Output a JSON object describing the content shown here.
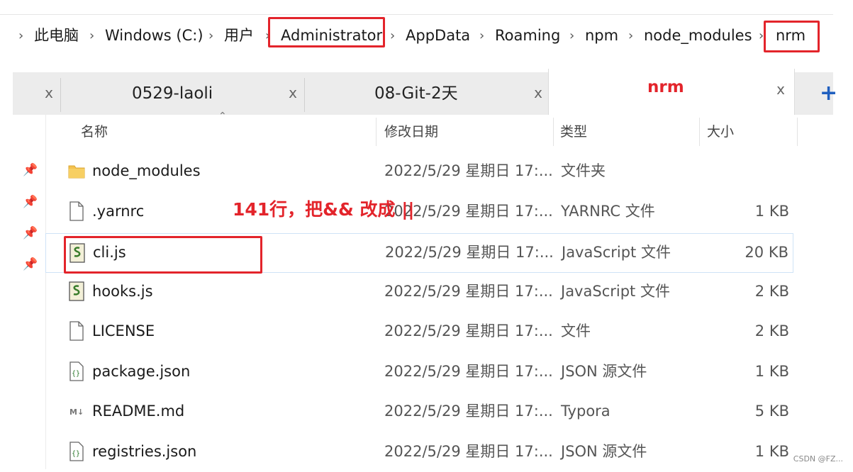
{
  "breadcrumb": {
    "items": [
      "此电脑",
      "Windows (C:)",
      "用户",
      "Administrator",
      "AppData",
      "Roaming",
      "npm",
      "node_modules",
      "nrm"
    ],
    "separator": "›"
  },
  "tabs": [
    {
      "label": "0529-laoli",
      "close": "x"
    },
    {
      "label": "08-Git-2天",
      "close": "x"
    },
    {
      "label": "nrm",
      "close": "x",
      "active": true
    }
  ],
  "new_tab": "+",
  "columns": {
    "name": "名称",
    "date": "修改日期",
    "type": "类型",
    "size": "大小"
  },
  "files": [
    {
      "name": "node_modules",
      "date": "2022/5/29 星期日 17:...",
      "type": "文件夹",
      "size": "",
      "icon": "folder-icon"
    },
    {
      "name": ".yarnrc",
      "date": "2022/5/29 星期日 17:...",
      "type": "YARNRC 文件",
      "size": "1 KB",
      "icon": "file-icon"
    },
    {
      "name": "cli.js",
      "date": "2022/5/29 星期日 17:...",
      "type": "JavaScript 文件",
      "size": "20 KB",
      "icon": "js-script-icon"
    },
    {
      "name": "hooks.js",
      "date": "2022/5/29 星期日 17:...",
      "type": "JavaScript 文件",
      "size": "2 KB",
      "icon": "js-script-icon"
    },
    {
      "name": "LICENSE",
      "date": "2022/5/29 星期日 17:...",
      "type": "文件",
      "size": "2 KB",
      "icon": "file-icon"
    },
    {
      "name": "package.json",
      "date": "2022/5/29 星期日 17:...",
      "type": "JSON 源文件",
      "size": "1 KB",
      "icon": "json-file-icon"
    },
    {
      "name": "README.md",
      "date": "2022/5/29 星期日 17:...",
      "type": "Typora",
      "size": "5 KB",
      "icon": "markdown-file-icon"
    },
    {
      "name": "registries.json",
      "date": "2022/5/29 星期日 17:...",
      "type": "JSON 源文件",
      "size": "1 KB",
      "icon": "json-file-icon"
    }
  ],
  "annotation": "141行，把&& 改成 ||",
  "watermark": "CSDN @FZ...",
  "colors": {
    "highlight": "#e3242b",
    "accent": "#1f5fbf",
    "folder": "#f4c24f"
  }
}
